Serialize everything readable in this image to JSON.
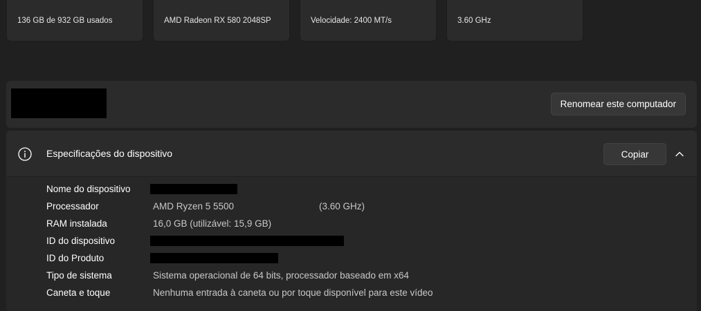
{
  "summary_cards": [
    {
      "text": "136 GB de 932 GB usados"
    },
    {
      "text": "AMD Radeon RX 580 2048SP"
    },
    {
      "text": "Velocidade: 2400 MT/s"
    },
    {
      "text": "3.60 GHz"
    }
  ],
  "rename": {
    "button_label": "Renomear este computador"
  },
  "specs": {
    "title": "Especificações do dispositivo",
    "copy_label": "Copiar",
    "icon": "info-icon",
    "collapse_icon": "chevron-up-icon",
    "rows": [
      {
        "label": "Nome do dispositivo",
        "value": "",
        "redacted": true
      },
      {
        "label": "Processador",
        "value": "AMD Ryzen 5 5500",
        "value2": "(3.60 GHz)"
      },
      {
        "label": "RAM instalada",
        "value": "16,0 GB (utilizável: 15,9 GB)"
      },
      {
        "label": "ID do dispositivo",
        "value": "",
        "redacted": true
      },
      {
        "label": "ID do Produto",
        "value": "",
        "redacted": true
      },
      {
        "label": "Tipo de sistema",
        "value": "Sistema operacional de 64 bits, processador baseado em x64"
      },
      {
        "label": "Caneta e toque",
        "value": "Nenhuma entrada à caneta ou por toque disponível para este vídeo"
      }
    ]
  },
  "colors": {
    "background": "#202020",
    "card": "#2b2b2b",
    "button": "#373737",
    "redaction": "#000000"
  }
}
